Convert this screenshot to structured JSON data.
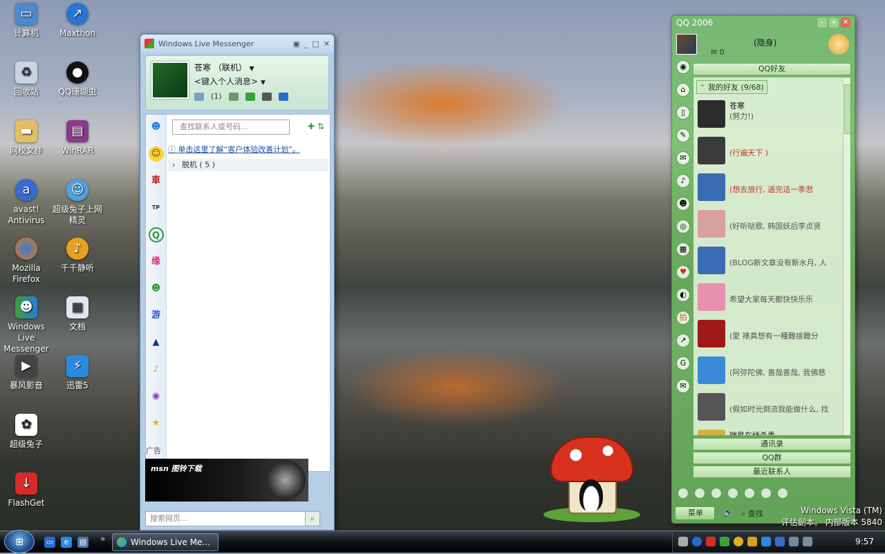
{
  "desktop_icons": [
    {
      "label": "计算机",
      "icon": "computer-icon"
    },
    {
      "label": "Maxthon",
      "icon": "maxthon-icon"
    },
    {
      "label": "回收站",
      "icon": "recycle-bin-icon"
    },
    {
      "label": "QQ珊瑚虫",
      "icon": "qq-icon"
    },
    {
      "label": "网校文件",
      "icon": "folder-icon"
    },
    {
      "label": "WinRAR",
      "icon": "winrar-icon"
    },
    {
      "label": "avast! Antivirus",
      "icon": "avast-icon"
    },
    {
      "label": "超级兔子上网精灵",
      "icon": "rabbit-net-icon"
    },
    {
      "label": "Mozilla Firefox",
      "icon": "firefox-icon"
    },
    {
      "label": "千千静听",
      "icon": "ttplayer-icon"
    },
    {
      "label": "Windows Live Messenger",
      "icon": "messenger-icon"
    },
    {
      "label": "文档",
      "icon": "documents-icon"
    },
    {
      "label": "暴风影音",
      "icon": "storm-player-icon"
    },
    {
      "label": "迅雷5",
      "icon": "thunder-icon"
    },
    {
      "label": "超级兔子",
      "icon": "rabbit-icon"
    },
    {
      "label": "FlashGet",
      "icon": "flashget-icon"
    }
  ],
  "msn": {
    "title": "Windows Live Messenger",
    "user_name": "苍寒  （联机）",
    "personal_message": "<键入个人消息>",
    "mail_count": "(1)",
    "search_placeholder": "查找联系人或号码...",
    "info_link": "单击这里了解“客户体验改善计划”。",
    "offline_group": "脱机 ( 5 )",
    "ad_label": "广告",
    "ad_brand": "msn 图铃下载",
    "web_search_placeholder": "搜索网页..."
  },
  "qq": {
    "title": "QQ 2006",
    "my_status": "(隐身)",
    "mail_count": "0",
    "tab_friends": "QQ好友",
    "group_label": "我的好友 (9/68)",
    "friends": [
      {
        "name": "苍寒",
        "signature": "(努力!)",
        "avatar_color": "#2c2c2c",
        "sig_color": "normal"
      },
      {
        "name": "",
        "signature": "(行遍天下 )",
        "avatar_color": "#3b3b3b",
        "sig_color": "red"
      },
      {
        "name": "",
        "signature": "(想去旅行, 過完這一季悲",
        "avatar_color": "#3b6bb3",
        "sig_color": "red"
      },
      {
        "name": "",
        "signature": "(好听哒歌, 韩国妖后李贞贤",
        "avatar_color": "#d8a0a0",
        "sig_color": "normal"
      },
      {
        "name": "",
        "signature": "(BLOG新文章没有新水月, 人",
        "avatar_color": "#3b6bb3",
        "sig_color": "normal"
      },
      {
        "name": "",
        "signature": "希望大家每天都快快乐乐",
        "avatar_color": "#e890b0",
        "sig_color": "normal"
      },
      {
        "name": "",
        "signature": "(愛 裱真想有一種難捨難分",
        "avatar_color": "#a01818",
        "sig_color": "normal"
      },
      {
        "name": "",
        "signature": "(阿弥陀佛, 善哉善哉, 我佛慈",
        "avatar_color": "#3a8ad8",
        "sig_color": "normal"
      },
      {
        "name": "",
        "signature": "(假如时光倒流我能做什么, 找",
        "avatar_color": "#555555",
        "sig_color": "normal"
      },
      {
        "name": "瑞星在线杀毒",
        "signature": "",
        "avatar_color": "#d8b040",
        "sig_color": "normal"
      }
    ],
    "tab_contacts": "通讯录",
    "tab_group": "QQ群",
    "tab_recent": "最近联系人",
    "menu_label": "菜单",
    "find_label": "查找"
  },
  "watermark": {
    "line1": "Windows Vista (TM)",
    "line2": "评估副本。 内部版本 5840"
  },
  "taskbar": {
    "task_label": "Windows Live Me...",
    "clock": "9:57"
  }
}
